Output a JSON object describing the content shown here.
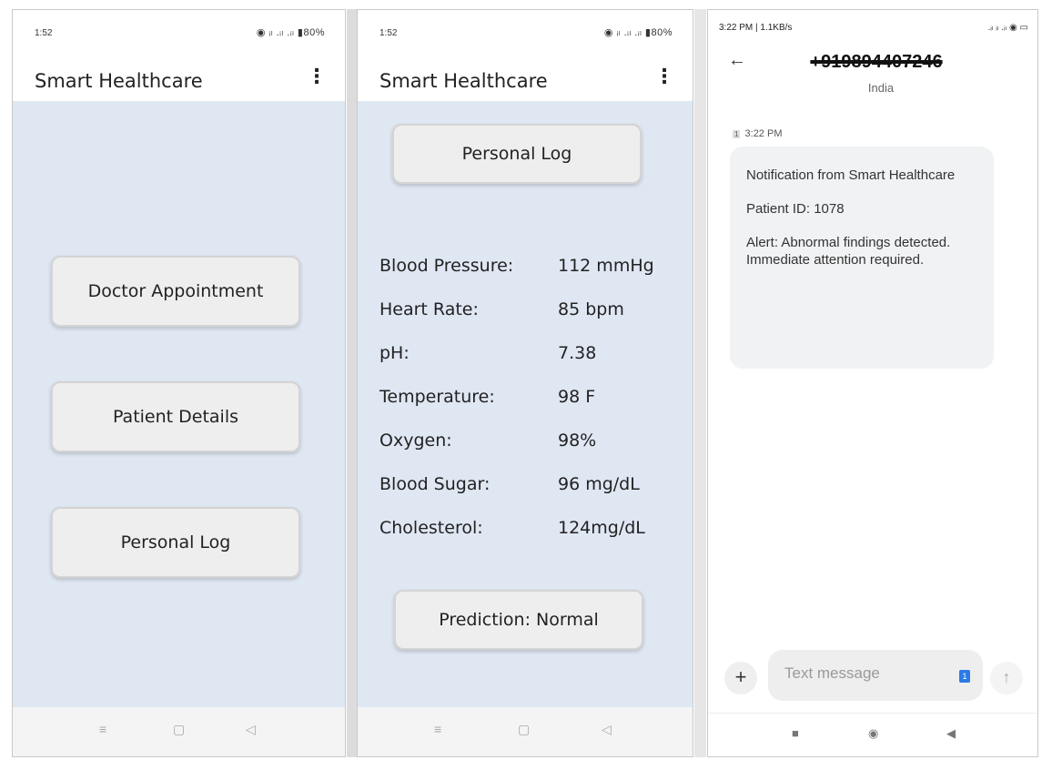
{
  "screen1": {
    "status": {
      "time": "1:52",
      "icons": "◉ ᵢₗ .ᵢₗ .ᵢₗ ▮80%"
    },
    "title": "Smart Healthcare",
    "menu_icon": "⋮",
    "buttons": {
      "doctor": "Doctor Appointment",
      "patient": "Patient Details",
      "personal": "Personal Log"
    },
    "nav": {
      "menu": "≡",
      "home": "▢",
      "back": "◁"
    }
  },
  "screen2": {
    "status": {
      "time": "1:52",
      "icons": "◉ ᵢₗ .ᵢₗ .ᵢₗ ▮80%"
    },
    "title": "Smart Healthcare",
    "menu_icon": "⋮",
    "header_button": "Personal Log",
    "vitals": [
      {
        "label": "Blood Pressure:",
        "value": "112 mmHg"
      },
      {
        "label": "Heart Rate:",
        "value": "85 bpm"
      },
      {
        "label": "pH:",
        "value": "7.38"
      },
      {
        "label": "Temperature:",
        "value": "98 F"
      },
      {
        "label": "Oxygen:",
        "value": "98%"
      },
      {
        "label": "Blood Sugar:",
        "value": "96 mg/dL"
      },
      {
        "label": "Cholesterol:",
        "value": "124mg/dL"
      }
    ],
    "prediction_button": "Prediction: Normal",
    "nav": {
      "menu": "≡",
      "home": "▢",
      "back": "◁"
    }
  },
  "screen3": {
    "status_left": "3:22 PM | 1.1KB/s",
    "status_right": ".ᵢₗ ᵢₗ .ᵢₗ ◉ ▭",
    "back_icon": "←",
    "phone_number": "+919894407246",
    "country": "India",
    "sim_badge": "1",
    "timestamp": "3:22 PM",
    "message": {
      "line1": "Notification from Smart Healthcare",
      "line2": "Patient ID: 1078",
      "line3": "Alert: Abnormal findings detected. Immediate attention required."
    },
    "compose_plus": "+",
    "compose_placeholder": "Text message",
    "compose_sim": "1",
    "send_icon": "↑",
    "nav": {
      "recent": "■",
      "home": "◉",
      "back": "◀"
    }
  },
  "colors": {
    "content_bg": "#dfe7f3",
    "button_bg": "#eeeeee",
    "bubble_bg": "#f1f2f4"
  }
}
